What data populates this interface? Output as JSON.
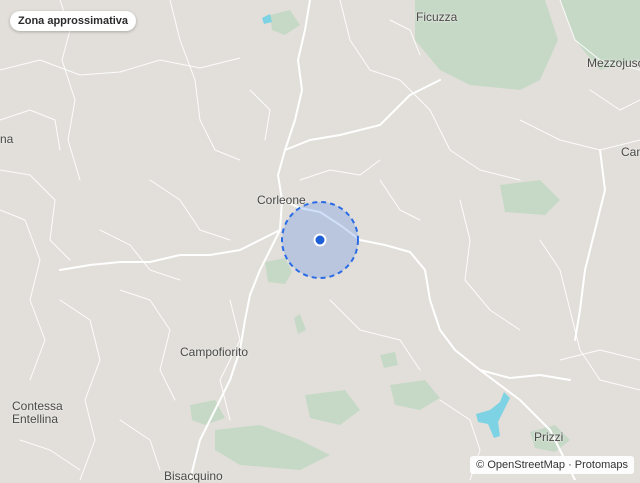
{
  "badge": {
    "label": "Zona approssimativa"
  },
  "places": {
    "ficuzza": "Ficuzza",
    "mezzojuso": "Mezzojuso",
    "cam": "Cam",
    "na": "na",
    "corleone": "Corleone",
    "campofiorito": "Campofiorito",
    "contessa_entellina": "Contessa\nEntellina",
    "prizzi": "Prizzi",
    "bisacquino": "Bisacquino"
  },
  "attribution": {
    "copyright_symbol": "©",
    "openstreetmap": "OpenStreetMap",
    "separator": "·",
    "protomaps": "Protomaps"
  },
  "colors": {
    "land": "#e2dfda",
    "forest": "#bcd7c0",
    "water": "#7dd3e3",
    "roads": "#ffffff",
    "accuracy_circle": "#2b6ce6",
    "location_dot": "#1f5fd6"
  },
  "icons": {
    "location": "location-dot-icon"
  }
}
